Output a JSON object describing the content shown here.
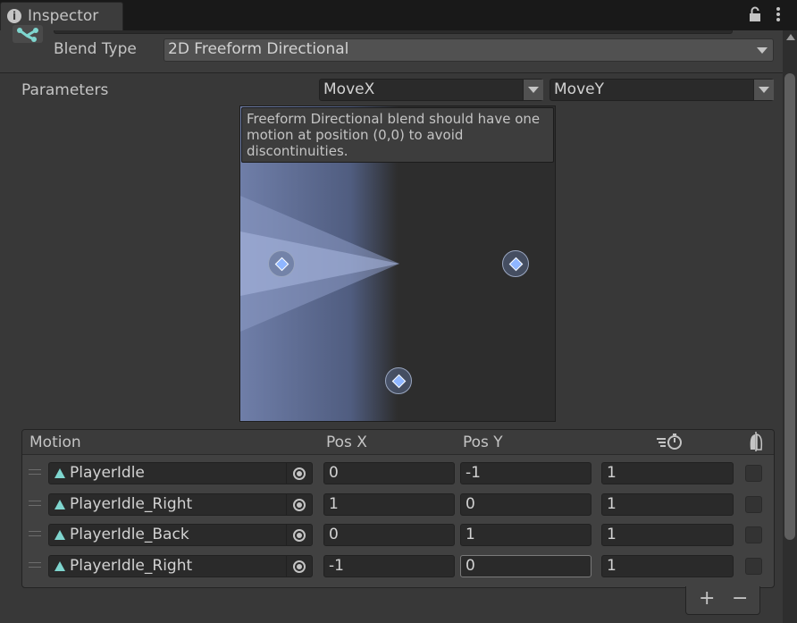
{
  "tab": {
    "title": "Inspector"
  },
  "header": {
    "blend_type_label": "Blend Type",
    "blend_type_value": "2D Freeform Directional"
  },
  "parameters": {
    "label": "Parameters",
    "x_param": "MoveX",
    "y_param": "MoveY"
  },
  "graph": {
    "warning": "Freeform Directional blend should have one motion at position (0,0) to avoid discontinuities.",
    "points": [
      {
        "x": 0,
        "y": -1
      },
      {
        "x": 1,
        "y": 0
      },
      {
        "x": 0,
        "y": 1
      },
      {
        "x": -1,
        "y": 0
      }
    ]
  },
  "table": {
    "headers": {
      "motion": "Motion",
      "posx": "Pos X",
      "posy": "Pos Y"
    },
    "rows": [
      {
        "motion": "PlayerIdle",
        "posx": "0",
        "posy": "-1",
        "speed": "1",
        "mirror": false
      },
      {
        "motion": "PlayerIdle_Right",
        "posx": "1",
        "posy": "0",
        "speed": "1",
        "mirror": false
      },
      {
        "motion": "PlayerIdle_Back",
        "posx": "0",
        "posy": "1",
        "speed": "1",
        "mirror": false
      },
      {
        "motion": "PlayerIdle_Right",
        "posx": "-1",
        "posy": "0",
        "speed": "1",
        "mirror": false
      }
    ],
    "add_label": "+",
    "remove_label": "−"
  },
  "colors": {
    "accent_point": "#8fb6ff",
    "background": "#383838"
  },
  "icons": [
    "info-icon",
    "lock-icon",
    "kebab-menu-icon",
    "blend-tree-icon",
    "animation-clip-icon",
    "object-picker-icon",
    "time-scale-icon",
    "mirror-icon"
  ]
}
